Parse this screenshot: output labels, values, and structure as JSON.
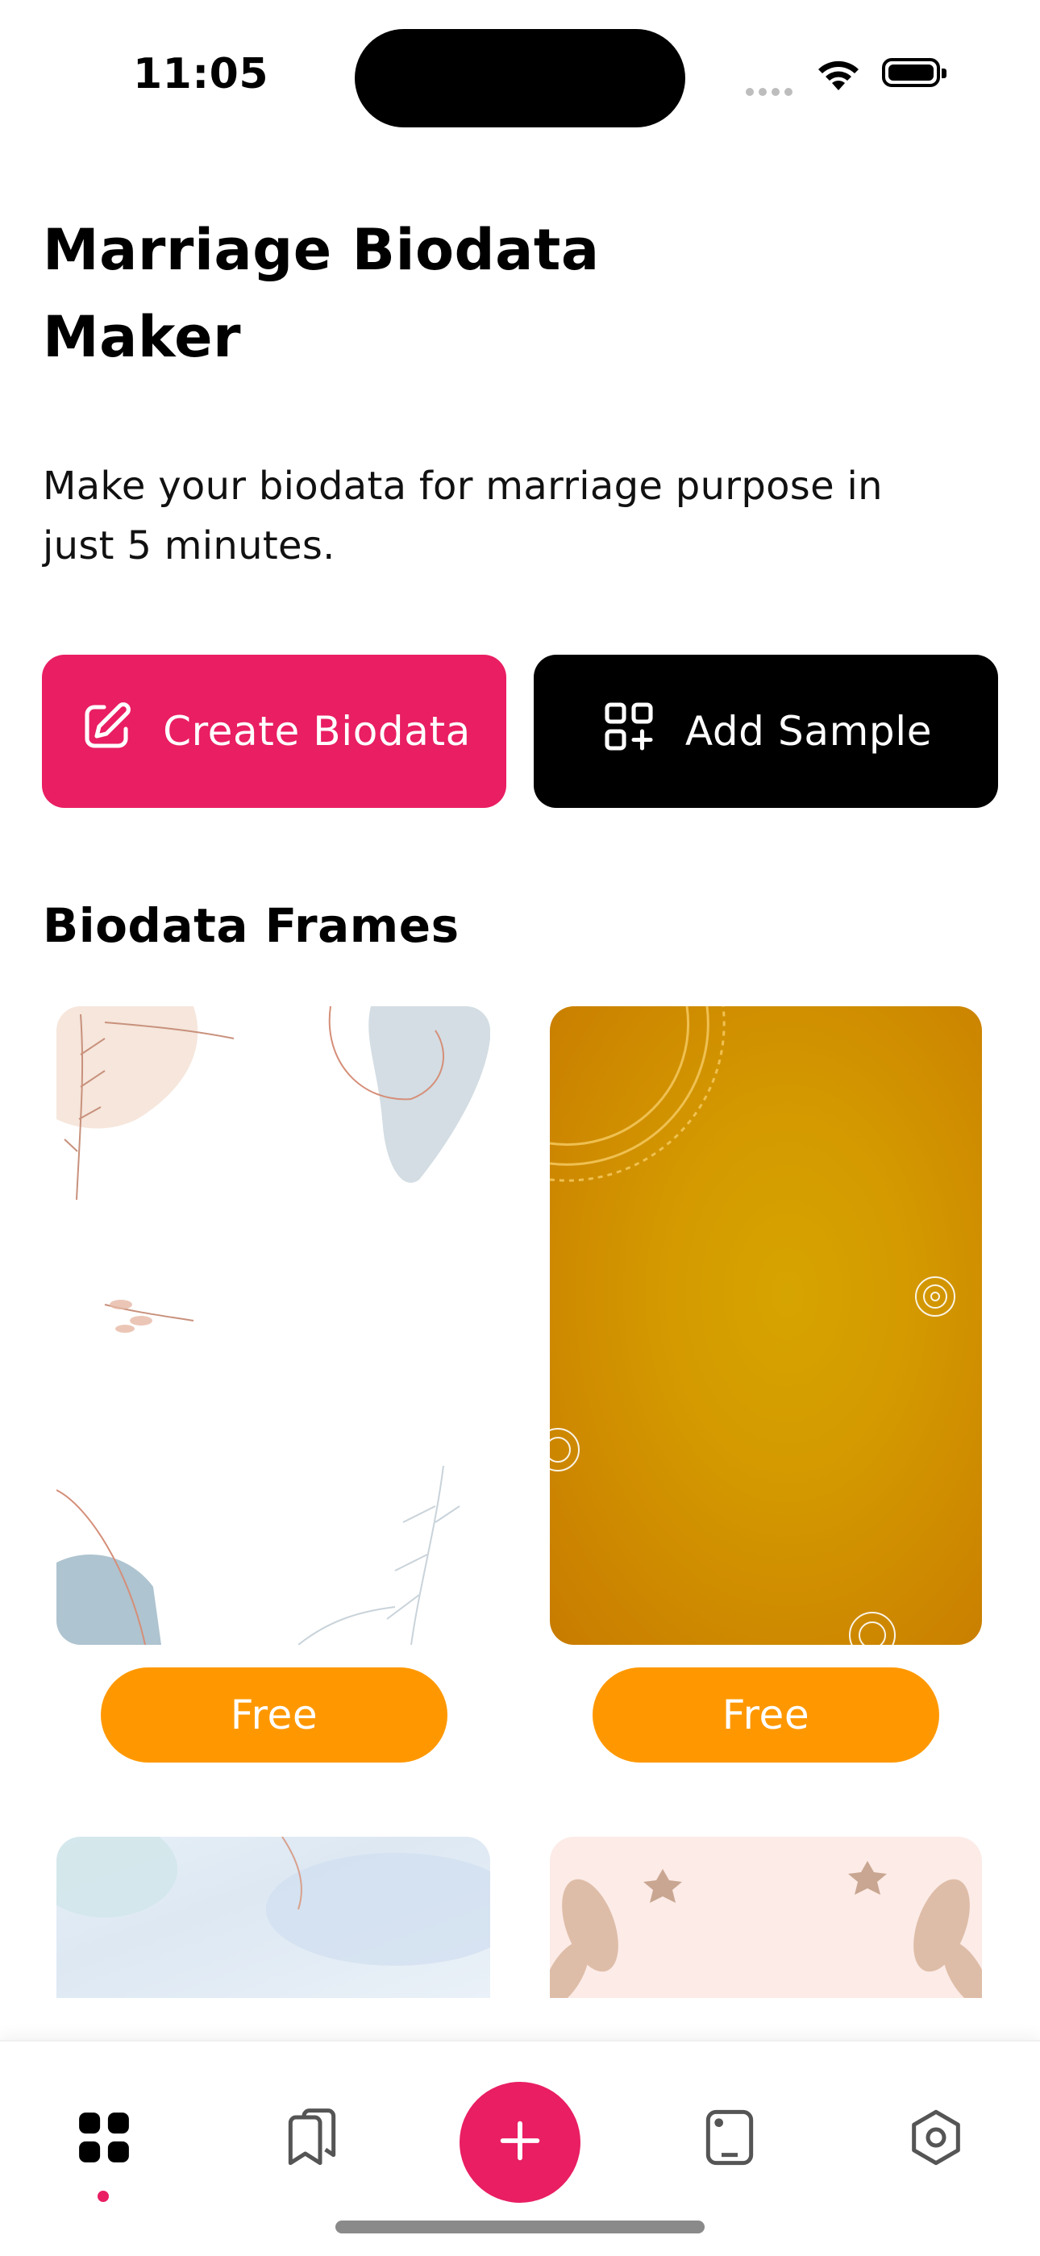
{
  "status_bar": {
    "time": "11:05"
  },
  "header": {
    "title": "Marriage Biodata Maker",
    "subtitle": "Make your biodata for marriage purpose in just 5 minutes."
  },
  "actions": {
    "create_label": "Create Biodata",
    "sample_label": "Add Sample"
  },
  "frames_section": {
    "title": "Biodata Frames",
    "frames": [
      {
        "badge": "Free"
      },
      {
        "badge": "Free"
      }
    ]
  },
  "tab_bar": {
    "items": [
      "grid-icon",
      "bookmarks-icon",
      "add-icon",
      "device-icon",
      "settings-icon"
    ],
    "active": "grid-icon"
  },
  "colors": {
    "primary": "#E91E63",
    "accent": "#FF9800",
    "dark": "#000000"
  }
}
